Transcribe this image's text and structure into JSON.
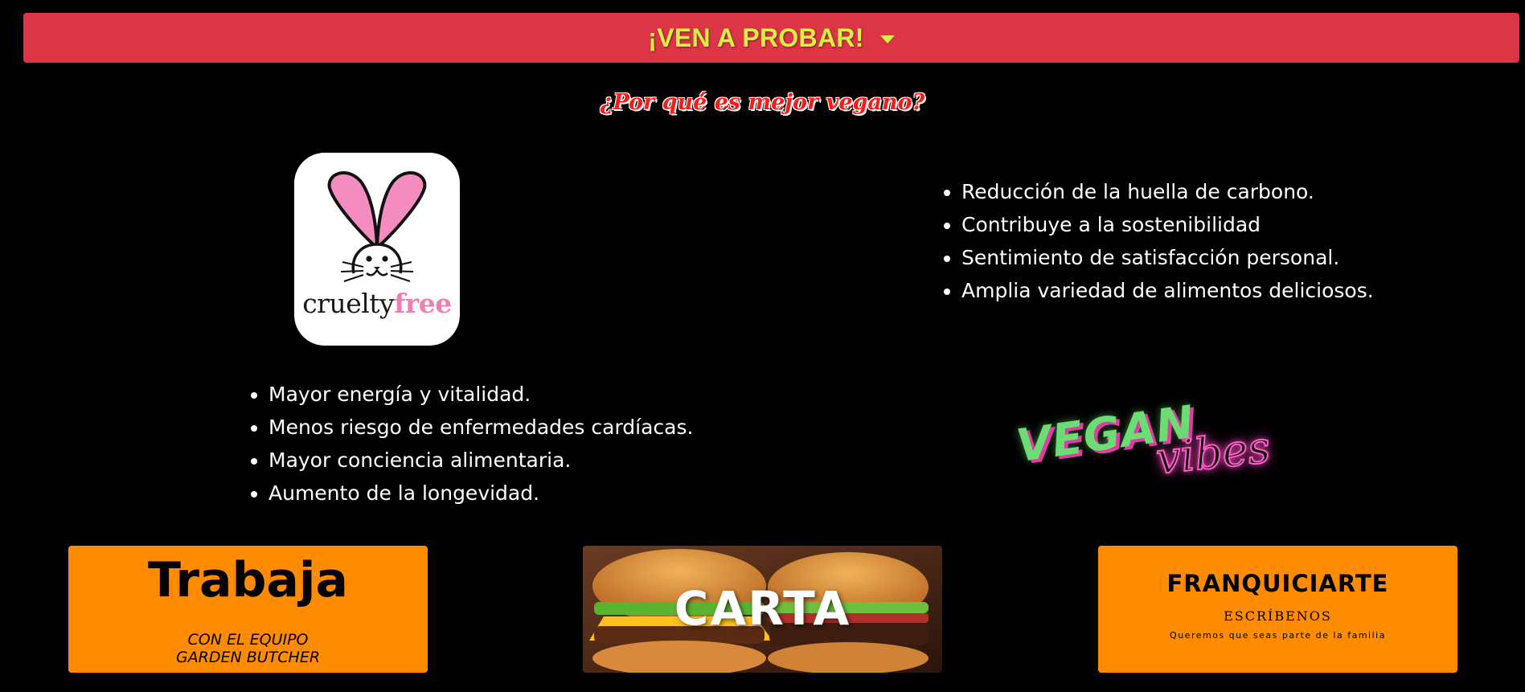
{
  "banner": {
    "label": "¡VEN A PROBAR!",
    "color": "#dc3545",
    "text_color": "#d7f043"
  },
  "section": {
    "question": "¿Por qué es mejor vegano?"
  },
  "logo": {
    "cruelty": "cruelty",
    "free": "free",
    "pink": "#ef7fb2"
  },
  "benefits_left": [
    "Mayor energía y vitalidad.",
    "Menos riesgo de enfermedades cardíacas.",
    "Mayor conciencia alimentaria.",
    "Aumento de la longevidad."
  ],
  "benefits_right": [
    "Reducción de la huella de carbono.",
    "Contribuye a la sostenibilidad",
    "Sentimiento de satisfacción personal.",
    "Amplia variedad de alimentos deliciosos."
  ],
  "badge": {
    "vegan": "VEGAN",
    "vibes": "vibes"
  },
  "cards": {
    "work": {
      "title": "Trabaja",
      "line1": "CON EL EQUIPO",
      "line2": "GARDEN BUTCHER"
    },
    "menu": {
      "title": "CARTA"
    },
    "franchise": {
      "title": "FRANQUICIARTE",
      "subtitle": "ESCRÍBENOS",
      "note": "Queremos que seas parte de la familia"
    },
    "accent": "#ff8c00"
  }
}
